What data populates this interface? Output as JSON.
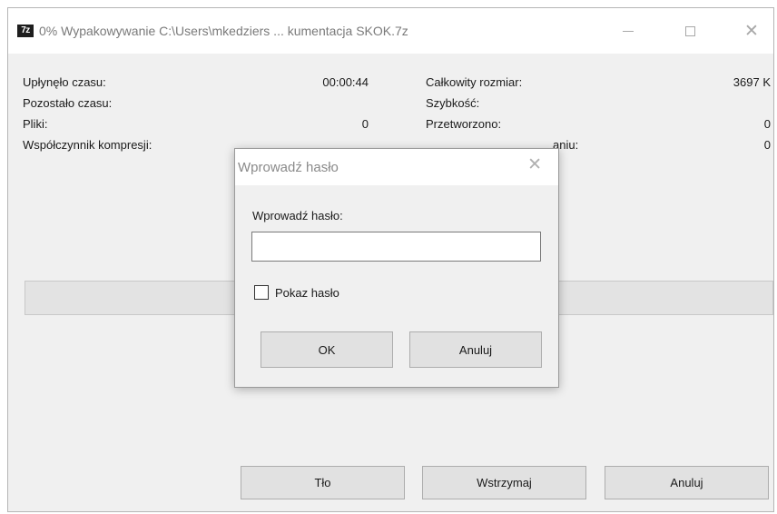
{
  "window": {
    "app_icon": "7z",
    "title": "0% Wypakowywanie C:\\Users\\mkedziers ... kumentacja SKOK.7z",
    "minimize_glyph": "—",
    "maximize_glyph": "☐",
    "close_glyph": "✕"
  },
  "stats_left": [
    {
      "label": "Upłynęło czasu:",
      "value": "00:00:44"
    },
    {
      "label": "Pozostało czasu:",
      "value": ""
    },
    {
      "label": "Pliki:",
      "value": "0"
    },
    {
      "label": "Współczynnik kompresji:",
      "value": ""
    }
  ],
  "stats_right": [
    {
      "label": "Całkowity rozmiar:",
      "value": "3697 K"
    },
    {
      "label": "Szybkość:",
      "value": ""
    },
    {
      "label": "Przetworzono:",
      "value": "0"
    },
    {
      "label": "aniu:",
      "value": "0"
    }
  ],
  "progress": {
    "percent": 0
  },
  "buttons": {
    "background": "Tło",
    "pause": "Wstrzymaj",
    "cancel": "Anuluj"
  },
  "dialog": {
    "title": "Wprowadź hasło",
    "close_glyph": "✕",
    "field_label": "Wprowadź hasło:",
    "password_value": "",
    "show_password_label": "Pokaz hasło",
    "show_password_checked": false,
    "ok_label": "OK",
    "cancel_label": "Anuluj"
  }
}
